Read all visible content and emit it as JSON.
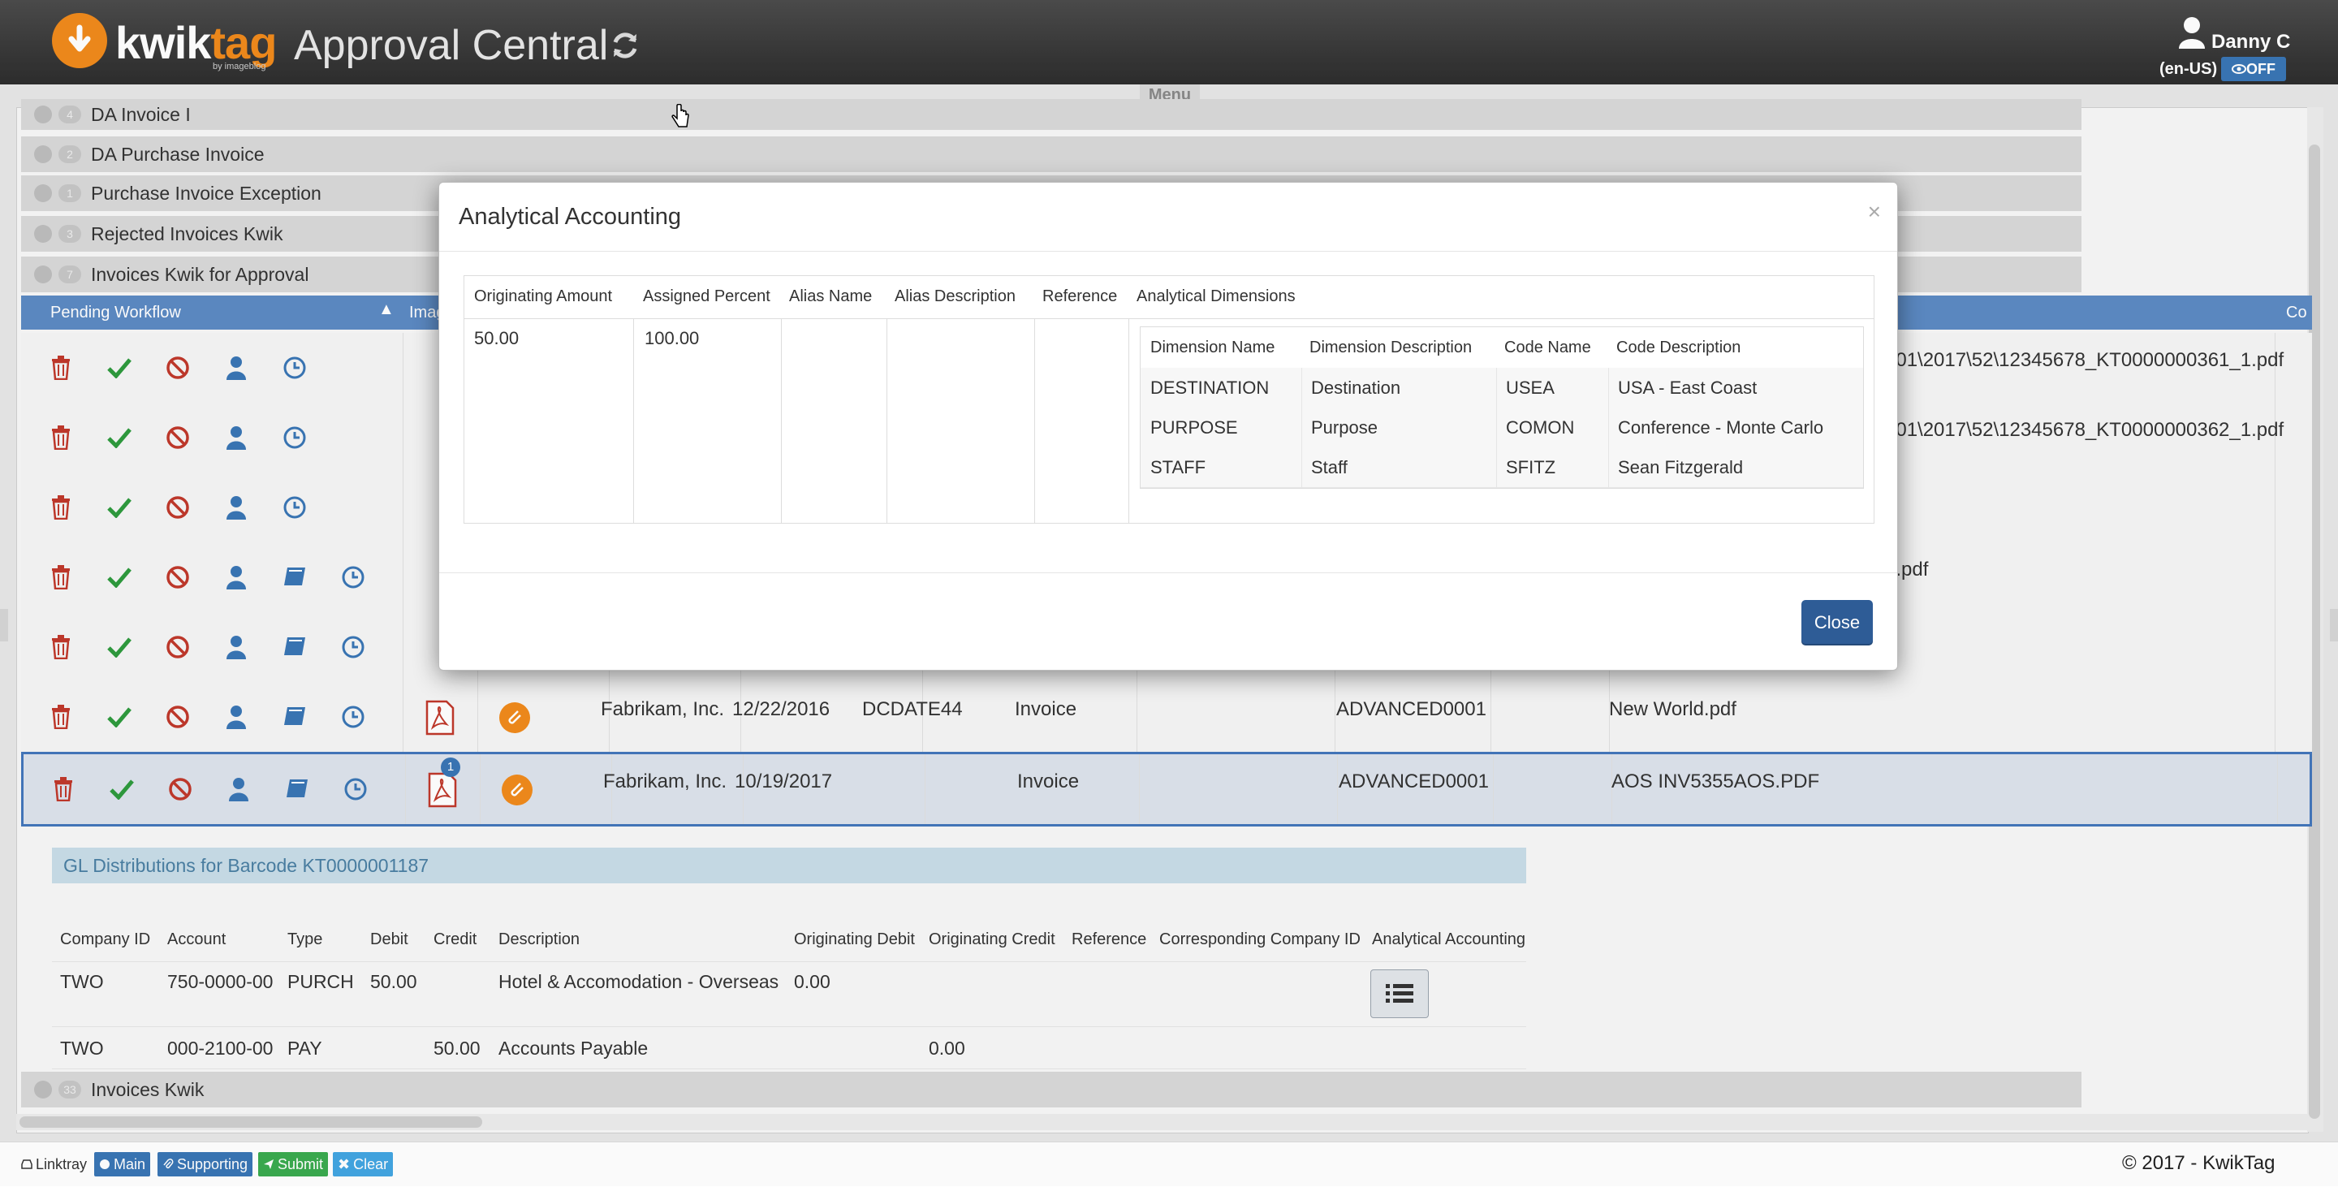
{
  "header": {
    "brand_kwik": "kwik",
    "brand_tag": "tag",
    "brand_sub": "by imageblog",
    "app_title": "Approval Central",
    "user_name": "Danny C",
    "user_locale": "(en-US)",
    "toggle_label": "OFF"
  },
  "menu_label": "Menu",
  "groups": [
    {
      "label": "DA Invoice I",
      "count": "4"
    },
    {
      "label": "DA Purchase Invoice",
      "count": "2"
    },
    {
      "label": "Purchase Invoice Exception",
      "count": "1"
    },
    {
      "label": "Rejected Invoices Kwik",
      "count": "3"
    },
    {
      "label": "Invoices Kwik for Approval",
      "count": "7"
    },
    {
      "label": "Invoices Kwik",
      "count": "33"
    }
  ],
  "table": {
    "headers": {
      "pending_workflow": "Pending Workflow",
      "image": "Imag",
      "last": "Co"
    },
    "rows": [
      {
        "vendor": "",
        "date": "",
        "doc": "",
        "type": "",
        "co": "",
        "file": "001\\2017\\52\\12345678_KT0000000361_1.pdf"
      },
      {
        "vendor": "",
        "date": "",
        "doc": "",
        "type": "",
        "co": "",
        "file": "001\\2017\\52\\12345678_KT0000000362_1.pdf"
      },
      {
        "vendor": "",
        "date": "",
        "doc": "",
        "type": "",
        "co": "",
        "file": ""
      },
      {
        "vendor": "",
        "date": "",
        "doc": "",
        "type": "",
        "co": "",
        "file": "5.pdf"
      },
      {
        "vendor": "",
        "date": "",
        "doc": "",
        "type": "",
        "co": "",
        "file": ""
      },
      {
        "vendor": "Fabrikam, Inc.",
        "date": "12/22/2016",
        "doc": "DCDATE44",
        "type": "Invoice",
        "co": "ADVANCED0001",
        "file": "New World.pdf"
      },
      {
        "vendor": "Fabrikam, Inc.",
        "date": "10/19/2017",
        "doc": "",
        "type": "Invoice",
        "co": "ADVANCED0001",
        "file": "AOS INV5355AOS.PDF",
        "badge": "1"
      }
    ]
  },
  "gl": {
    "title": "GL Distributions for Barcode KT0000001187",
    "headers": [
      "Company ID",
      "Account",
      "Type",
      "Debit",
      "Credit",
      "Description",
      "Originating Debit",
      "Originating Credit",
      "Reference",
      "Corresponding Company ID",
      "Analytical Accounting"
    ],
    "rows": [
      {
        "company": "TWO",
        "account": "750-0000-00",
        "type": "PURCH",
        "debit": "50.00",
        "credit": "",
        "description": "Hotel & Accomodation - Overseas",
        "orig_debit": "0.00",
        "orig_credit": ""
      },
      {
        "company": "TWO",
        "account": "000-2100-00",
        "type": "PAY",
        "debit": "",
        "credit": "50.00",
        "description": "Accounts Payable",
        "orig_debit": "",
        "orig_credit": "0.00"
      }
    ]
  },
  "footer": {
    "linktray": "Linktray",
    "main": "Main",
    "supporting": "Supporting",
    "submit": "Submit",
    "clear": "Clear",
    "copyright": "© 2017 - KwikTag"
  },
  "modal": {
    "title": "Analytical Accounting",
    "close_x": "×",
    "headers": {
      "orig_amount": "Originating Amount",
      "assigned_percent": "Assigned Percent",
      "alias_name": "Alias Name",
      "alias_desc": "Alias Description",
      "reference": "Reference",
      "dimensions": "Analytical Dimensions"
    },
    "values": {
      "orig_amount": "50.00",
      "assigned_percent": "100.00"
    },
    "dim_headers": [
      "Dimension Name",
      "Dimension Description",
      "Code Name",
      "Code Description"
    ],
    "dims": [
      {
        "name": "DESTINATION",
        "desc": "Destination",
        "code": "USEA",
        "code_desc": "USA - East Coast"
      },
      {
        "name": "PURPOSE",
        "desc": "Purpose",
        "code": "COMON",
        "code_desc": "Conference - Monte Carlo"
      },
      {
        "name": "STAFF",
        "desc": "Staff",
        "code": "SFITZ",
        "code_desc": "Sean Fitzgerald"
      }
    ],
    "close_label": "Close"
  },
  "colors": {
    "brand_orange": "#f08a1c",
    "header_blue": "#5c8ac3",
    "close_blue": "#2e5c96",
    "approve_green": "#2e9b3e",
    "reject_red": "#c0392b"
  }
}
